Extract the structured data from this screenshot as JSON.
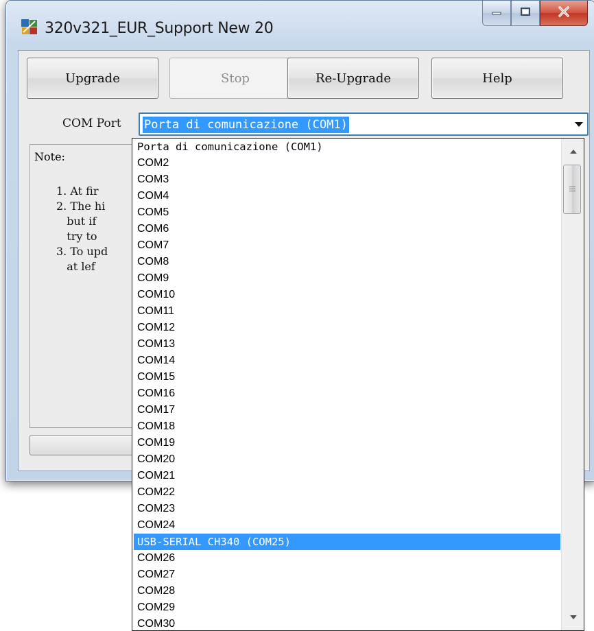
{
  "window": {
    "title": "320v321_EUR_Support New 20",
    "icon": "app-icon",
    "controls": [
      "minimize-icon",
      "maximize-icon",
      "close-icon"
    ]
  },
  "toolbar": {
    "upgrade_label": "Upgrade",
    "stop_label": "Stop",
    "reupgrade_label": "Re-Upgrade",
    "help_label": "Help"
  },
  "com_port": {
    "label": "COM Port",
    "selected": "Porta di comunicazione (COM1)"
  },
  "note": {
    "title": "Note:",
    "lines": [
      "1. At fir",
      "2. The hi",
      "   but if",
      "   try to",
      "3. To upd",
      "   at lef"
    ]
  },
  "dropdown": {
    "highlighted": "USB-SERIAL CH340 (COM25)",
    "options": [
      "Porta di comunicazione (COM1)",
      "COM2",
      "COM3",
      "COM4",
      "COM5",
      "COM6",
      "COM7",
      "COM8",
      "COM9",
      "COM10",
      "COM11",
      "COM12",
      "COM13",
      "COM14",
      "COM15",
      "COM16",
      "COM17",
      "COM18",
      "COM19",
      "COM20",
      "COM21",
      "COM22",
      "COM23",
      "COM24",
      "USB-SERIAL CH340 (COM25)",
      "COM26",
      "COM27",
      "COM28",
      "COM29",
      "COM30"
    ]
  },
  "colors": {
    "selection": "#3399ff",
    "window_frame": "#c4d4e8",
    "close_button": "#c23521"
  }
}
